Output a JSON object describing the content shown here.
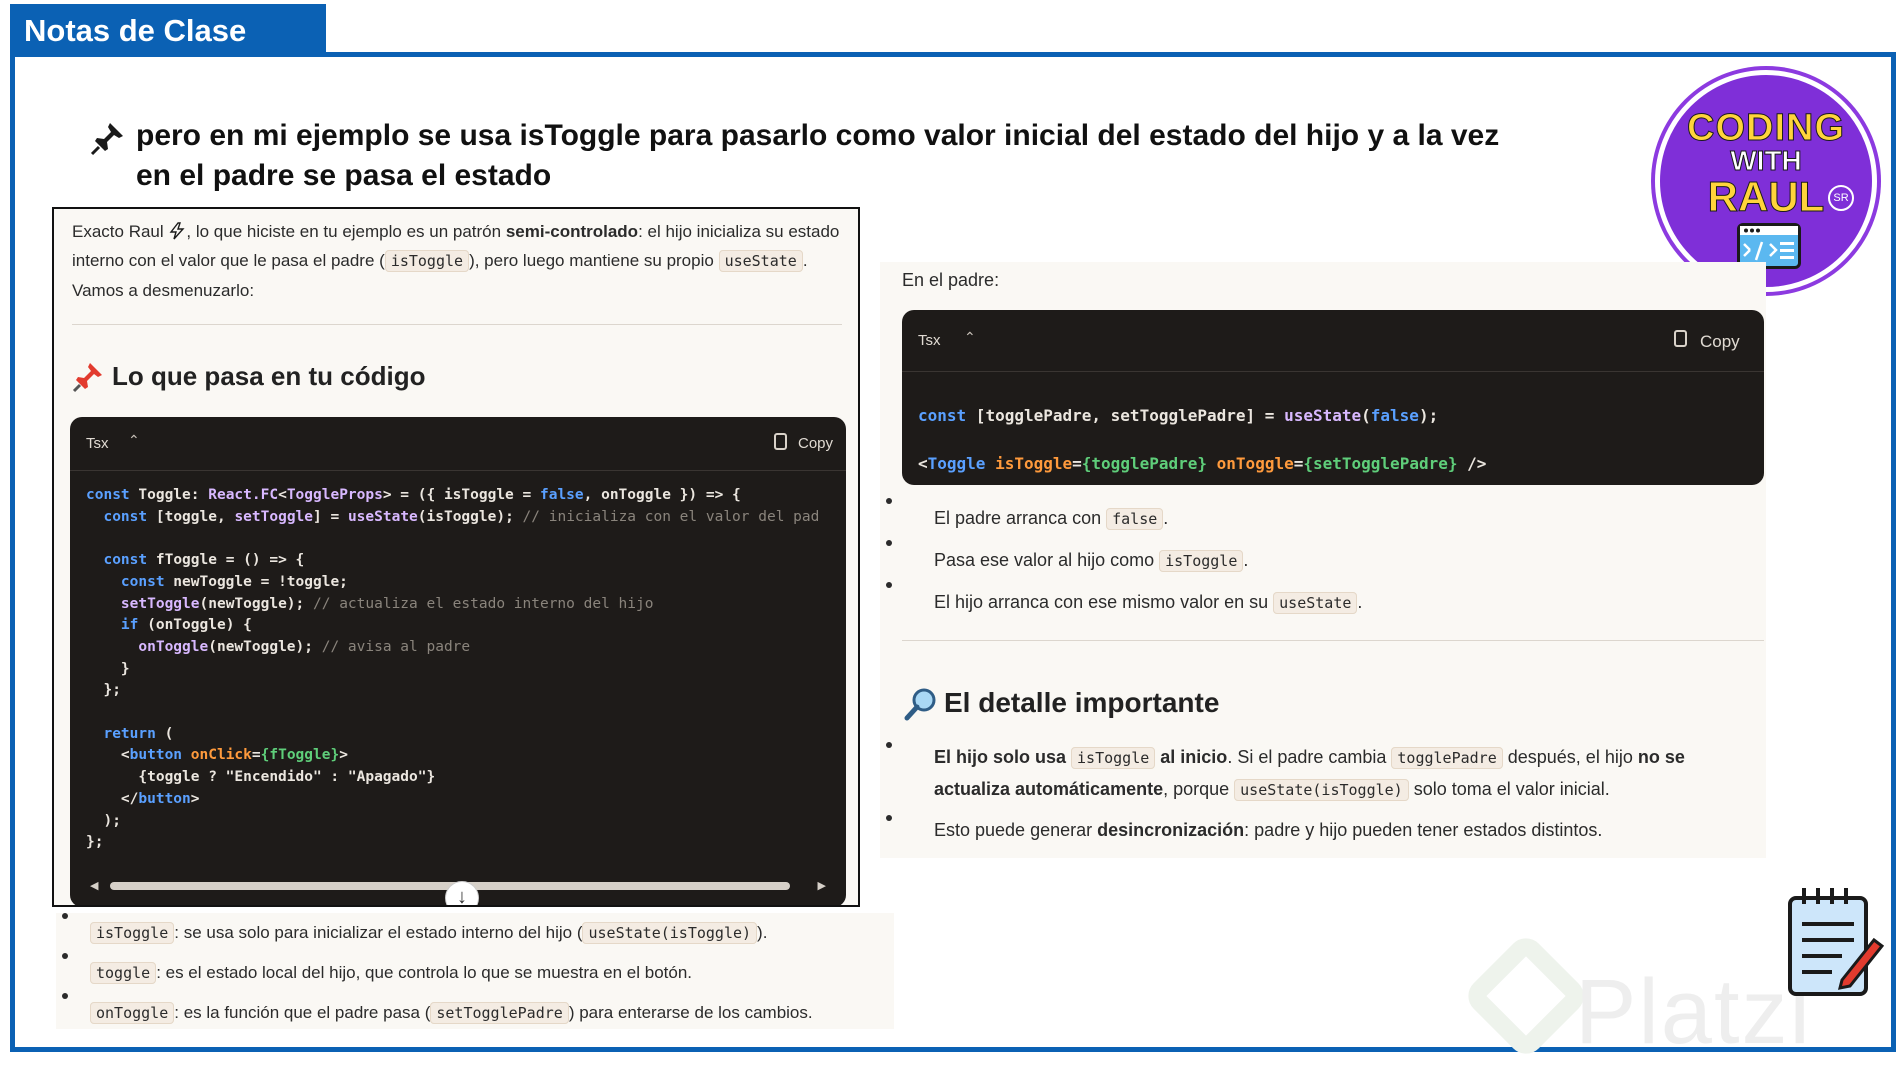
{
  "slide": {
    "header_title": "Notas de Clase",
    "heading": "pero en mi ejemplo se usa isToggle para pasarlo como valor inicial del estado del hijo y a la vez en el padre se pasa el estado",
    "logo": {
      "line1": "CODING",
      "line2": "WITH",
      "line3": "RAUL",
      "badge": "SR"
    },
    "watermark": "Platzi",
    "colors": {
      "frame": "#0b61b4",
      "logo_bg": "#7f2fd8",
      "code_bg": "#1e1b19"
    }
  },
  "left": {
    "intro_pre": "Exacto Raul ",
    "intro_emoji_icon": "lightning-icon",
    "intro_mid": ", lo que hiciste en tu ejemplo es un patrón ",
    "intro_bold": "semi-controlado",
    "intro_post": ": el hijo inicializa su estado interno con el valor que le pasa el padre (",
    "intro_code1": "isToggle",
    "intro_post2": "), pero luego mantiene su propio ",
    "intro_code2": "useState",
    "intro_end": ". Vamos a desmenuzarlo:",
    "section_title": "Lo que pasa en tu código",
    "code_lang": "Tsx",
    "copy_label": "Copy",
    "code_lines": [
      "const Toggle: React.FC<ToggleProps> = ({ isToggle = false, onToggle }) => {",
      "  const [toggle, setToggle] = useState(isToggle); // inicializa con el valor del pad",
      "",
      "  const fToggle = () => {",
      "    const newToggle = !toggle;",
      "    setToggle(newToggle); // actualiza el estado interno del hijo",
      "    if (onToggle) {",
      "      onToggle(newToggle); // avisa al padre",
      "    }",
      "  };",
      "",
      "  return (",
      "    <button onClick={fToggle}>",
      "      {toggle ? \"Encendido\" : \"Apagado\"}",
      "    </button>",
      "  );",
      "};"
    ],
    "bullets": [
      {
        "code": "isToggle",
        "text": ": se usa solo para inicializar el estado interno del hijo (",
        "code2": "useState(isToggle)",
        "text2": ")."
      },
      {
        "code": "toggle",
        "text": ": es el estado local del hijo, que controla lo que se muestra en el botón."
      },
      {
        "code": "onToggle",
        "text": ": es la función que el padre pasa (",
        "code2": "setTogglePadre",
        "text2": ") para enterarse de los cambios."
      }
    ]
  },
  "right": {
    "label": "En el padre:",
    "code_lang": "Tsx",
    "copy_label": "Copy",
    "code_line1": "const [togglePadre, setTogglePadre] = useState(false);",
    "code_line2": "<Toggle isToggle={togglePadre} onToggle={setTogglePadre} />",
    "bullets": [
      {
        "text": "El padre arranca con ",
        "code": "false",
        "end": "."
      },
      {
        "text": "Pasa ese valor al hijo como ",
        "code": "isToggle",
        "end": "."
      },
      {
        "text": "El hijo arranca con ese mismo valor en su ",
        "code": "useState",
        "end": "."
      }
    ],
    "section_title": "El detalle importante",
    "detail1_bold1": "El hijo solo usa ",
    "detail1_code1": "isToggle",
    "detail1_bold2": " al inicio",
    "detail1_text1": ". Si el padre cambia ",
    "detail1_code2": "togglePadre",
    "detail1_text2": " después, el hijo ",
    "detail1_bold3": "no se actualiza automáticamente",
    "detail1_text3": ", porque ",
    "detail1_code3": "useState(isToggle)",
    "detail1_text4": " solo toma el valor inicial.",
    "detail2_text1": "Esto puede generar ",
    "detail2_bold": "desincronización",
    "detail2_text2": ": padre y hijo pueden tener estados distintos."
  }
}
